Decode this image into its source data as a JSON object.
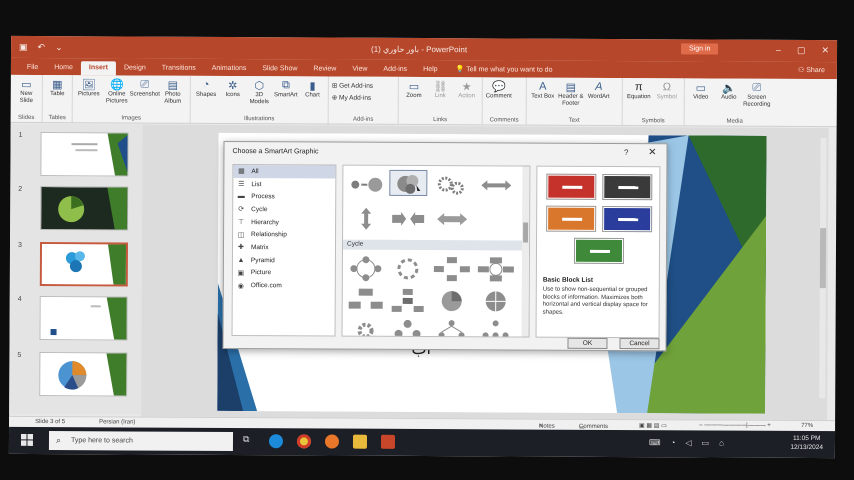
{
  "titlebar": {
    "doc_title": "باور حاوري (1) - PowerPoint",
    "signin": "Sign in"
  },
  "tabs": [
    "File",
    "Home",
    "Insert",
    "Design",
    "Transitions",
    "Animations",
    "Slide Show",
    "Review",
    "View",
    "Add-ins",
    "Help"
  ],
  "active_tab": "Insert",
  "tellme": "Tell me what you want to do",
  "share": "Share",
  "ribbon": {
    "slides": {
      "new_slide": "New Slide",
      "group": "Slides"
    },
    "tables": {
      "table": "Table",
      "group": "Tables"
    },
    "images": {
      "pictures": "Pictures",
      "online_pictures": "Online Pictures",
      "screenshot": "Screenshot",
      "photo_album": "Photo Album",
      "group": "Images"
    },
    "illustrations": {
      "shapes": "Shapes",
      "icons": "Icons",
      "models": "3D Models",
      "smartart": "SmartArt",
      "chart": "Chart",
      "group": "Illustrations"
    },
    "addins": {
      "get": "Get Add-ins",
      "my": "My Add-ins",
      "group": "Add-ins"
    },
    "links": {
      "zoom": "Zoom",
      "link": "Link",
      "action": "Action",
      "group": "Links"
    },
    "comments": {
      "comment": "Comment",
      "group": "Comments"
    },
    "text": {
      "textbox": "Text Box",
      "header": "Header & Footer",
      "wordart": "WordArt",
      "group": "Text"
    },
    "symbols": {
      "equation": "Equation",
      "symbol": "Symbol",
      "group": "Symbols"
    },
    "media": {
      "video": "Video",
      "audio": "Audio",
      "screen": "Screen Recording",
      "group": "Media"
    }
  },
  "slides": [
    {
      "num": "1"
    },
    {
      "num": "2"
    },
    {
      "num": "3"
    },
    {
      "num": "4"
    },
    {
      "num": "5"
    }
  ],
  "slide_text": "آب",
  "dialog": {
    "title": "Choose a SmartArt Graphic",
    "help": "?",
    "close": "✕",
    "categories": [
      "All",
      "List",
      "Process",
      "Cycle",
      "Hierarchy",
      "Relationship",
      "Matrix",
      "Pyramid",
      "Picture",
      "Office.com"
    ],
    "section_label": "Cycle",
    "preview_name": "Basic Block List",
    "preview_desc": "Use to show non-sequential or grouped blocks of information. Maximizes both horizontal and vertical display space for shapes.",
    "ok": "OK",
    "cancel": "Cancel",
    "preview_colors": [
      "#c4322b",
      "#3a3a3a",
      "#d9782d",
      "#2a3d9c",
      "#3f8a3a"
    ]
  },
  "statusbar": {
    "slide_info": "Slide 3 of 5",
    "language": "Persian (Iran)",
    "notes": "Notes",
    "comments": "Comments",
    "zoom": "77%"
  },
  "taskbar": {
    "search_placeholder": "Type here to search",
    "time": "11:05 PM",
    "date": "12/13/2024"
  }
}
